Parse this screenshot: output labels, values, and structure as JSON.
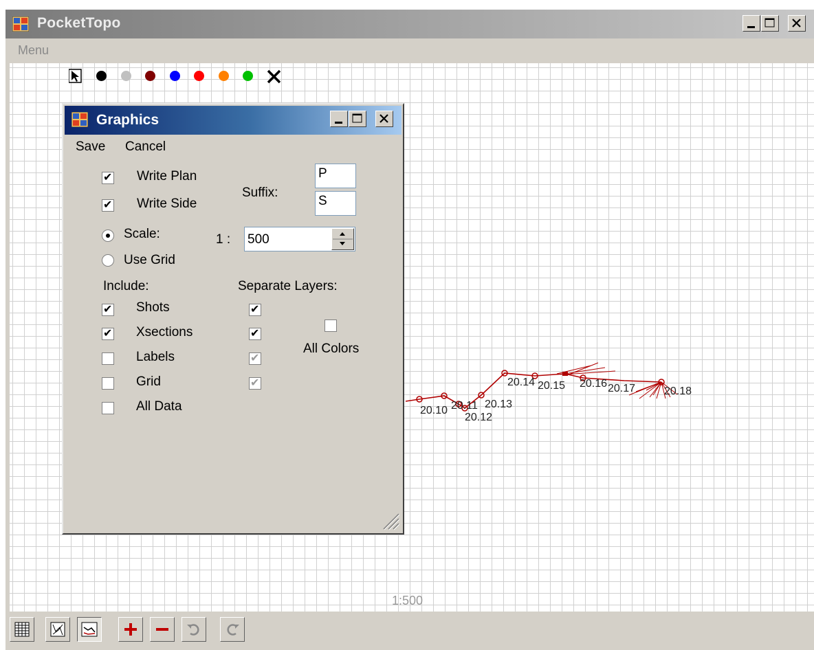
{
  "app": {
    "title": "PocketTopo",
    "menu_label": "Menu",
    "scale_label": "1:500"
  },
  "palette": {
    "colors": [
      "#000000",
      "#c0c0c0",
      "#800000",
      "#0000ff",
      "#ff0000",
      "#ff8000",
      "#00c000"
    ],
    "pointer_icon": "pointer-arrow-icon",
    "delete_icon": "x-delete-icon"
  },
  "survey": {
    "line_color": "#b00000",
    "stations": [
      "20.10",
      "20.11",
      "20.12",
      "20.13",
      "20.14",
      "20.15",
      "20.16",
      "20.17",
      "20.18"
    ]
  },
  "dialog": {
    "title": "Graphics",
    "menu": {
      "save": "Save",
      "cancel": "Cancel"
    },
    "write_plan_label": "Write Plan",
    "write_plan_checked": true,
    "write_side_label": "Write Side",
    "write_side_checked": true,
    "suffix_label": "Suffix:",
    "suffix_plan": "P",
    "suffix_side": "S",
    "scale_label": "Scale:",
    "scale_prefix": "1 :",
    "scale_value": "500",
    "use_grid_label": "Use Grid",
    "scale_mode": "scale",
    "include_label": "Include:",
    "separate_layers_label": "Separate Layers:",
    "include_items": [
      {
        "label": "Shots",
        "include": true,
        "layer": true,
        "layer_enabled": true
      },
      {
        "label": "Xsections",
        "include": true,
        "layer": true,
        "layer_enabled": true
      },
      {
        "label": "Labels",
        "include": false,
        "layer": true,
        "layer_enabled": false
      },
      {
        "label": "Grid",
        "include": false,
        "layer": true,
        "layer_enabled": false
      },
      {
        "label": "All Data",
        "include": false
      }
    ],
    "all_colors_label": "All Colors",
    "all_colors_checked": false
  },
  "toolbar": {
    "buttons": [
      "table-icon",
      "sketch-plan-icon",
      "sketch-side-icon",
      "zoom-in-icon",
      "zoom-out-icon",
      "undo-icon",
      "redo-icon"
    ]
  }
}
